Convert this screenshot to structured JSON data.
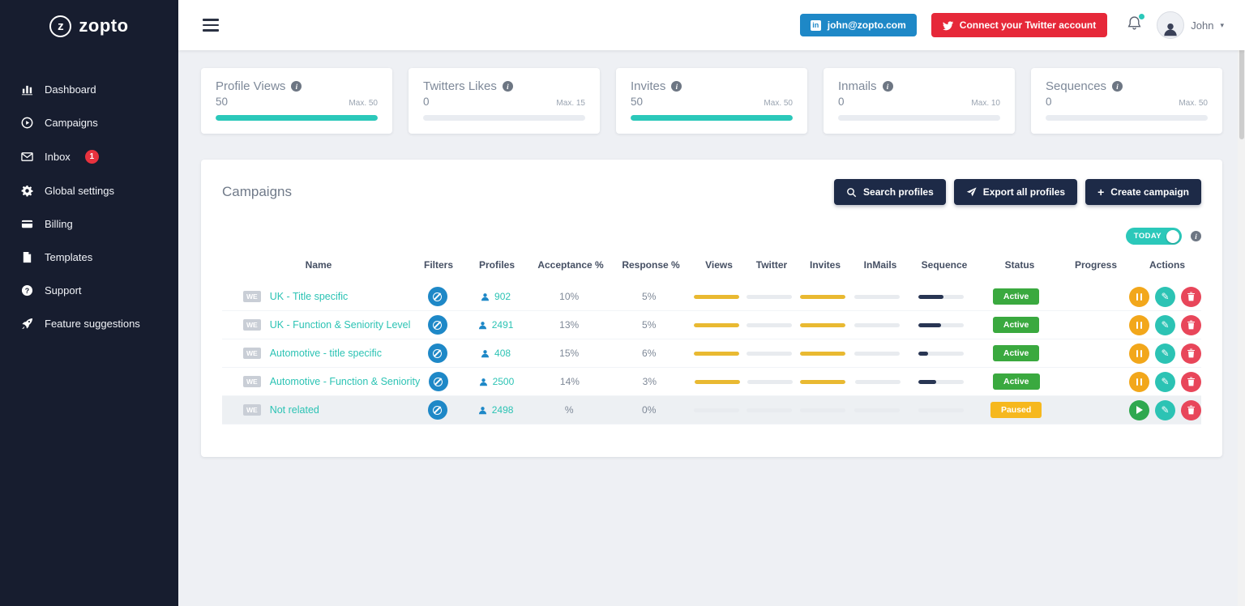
{
  "brand": {
    "name": "zopto",
    "mark": "z"
  },
  "sidebar": {
    "items": [
      {
        "label": "Dashboard"
      },
      {
        "label": "Campaigns"
      },
      {
        "label": "Inbox",
        "badge": "1"
      },
      {
        "label": "Global settings"
      },
      {
        "label": "Billing"
      },
      {
        "label": "Templates"
      },
      {
        "label": "Support"
      },
      {
        "label": "Feature suggestions"
      }
    ]
  },
  "topbar": {
    "email_badge": "john@zopto.com",
    "linkedin_glyph": "in",
    "twitter_button": "Connect your Twitter account",
    "user_name": "John",
    "caret": "▾"
  },
  "stats": [
    {
      "label": "Profile Views",
      "value": "50",
      "max_label": "Max. 50",
      "percent": 100
    },
    {
      "label": "Twitters Likes",
      "value": "0",
      "max_label": "Max. 15",
      "percent": 0
    },
    {
      "label": "Invites",
      "value": "50",
      "max_label": "Max. 50",
      "percent": 100
    },
    {
      "label": "Inmails",
      "value": "0",
      "max_label": "Max. 10",
      "percent": 0
    },
    {
      "label": "Sequences",
      "value": "0",
      "max_label": "Max. 50",
      "percent": 0
    }
  ],
  "campaigns_panel": {
    "title": "Campaigns",
    "buttons": {
      "search": "Search profiles",
      "export": "Export all profiles",
      "create": "Create campaign",
      "create_plus": "+"
    },
    "toggle_label": "TODAY",
    "table": {
      "headers": [
        "Name",
        "Filters",
        "Profiles",
        "Acceptance %",
        "Response %",
        "Views",
        "Twitter",
        "Invites",
        "InMails",
        "Sequence",
        "Status",
        "Progress",
        "Actions"
      ],
      "rows": [
        {
          "tag": "WE",
          "name": "UK - Title specific",
          "profiles": "902",
          "acceptance": "10%",
          "response": "5%",
          "views": 100,
          "twitter": 0,
          "invites": 100,
          "inmails": 0,
          "sequence": 55,
          "status": "Active"
        },
        {
          "tag": "WE",
          "name": "UK - Function & Seniority Level",
          "profiles": "2491",
          "acceptance": "13%",
          "response": "5%",
          "views": 100,
          "twitter": 0,
          "invites": 100,
          "inmails": 0,
          "sequence": 50,
          "status": "Active"
        },
        {
          "tag": "WE",
          "name": "Automotive - title specific",
          "profiles": "408",
          "acceptance": "15%",
          "response": "6%",
          "views": 100,
          "twitter": 0,
          "invites": 100,
          "inmails": 0,
          "sequence": 22,
          "status": "Active"
        },
        {
          "tag": "WE",
          "name": "Automotive - Function & Seniority",
          "profiles": "2500",
          "acceptance": "14%",
          "response": "3%",
          "views": 100,
          "twitter": 0,
          "invites": 100,
          "inmails": 0,
          "sequence": 38,
          "status": "Active"
        },
        {
          "tag": "WE",
          "name": "Not related",
          "profiles": "2498",
          "acceptance": "%",
          "response": "0%",
          "views": 0,
          "twitter": 0,
          "invites": 0,
          "inmails": 0,
          "sequence": 0,
          "status": "Paused"
        }
      ]
    }
  },
  "colors": {
    "teal": "#2bc8ba",
    "yellow_bar": "#e9b931",
    "navy_bar": "#283553",
    "sidebar_bg": "#171d2f",
    "active_green": "#3aa93f",
    "paused_yellow": "#f6b81e",
    "linkedin_blue": "#1e88c7",
    "twitter_red": "#e62839",
    "dark_button": "#1d2a47"
  }
}
